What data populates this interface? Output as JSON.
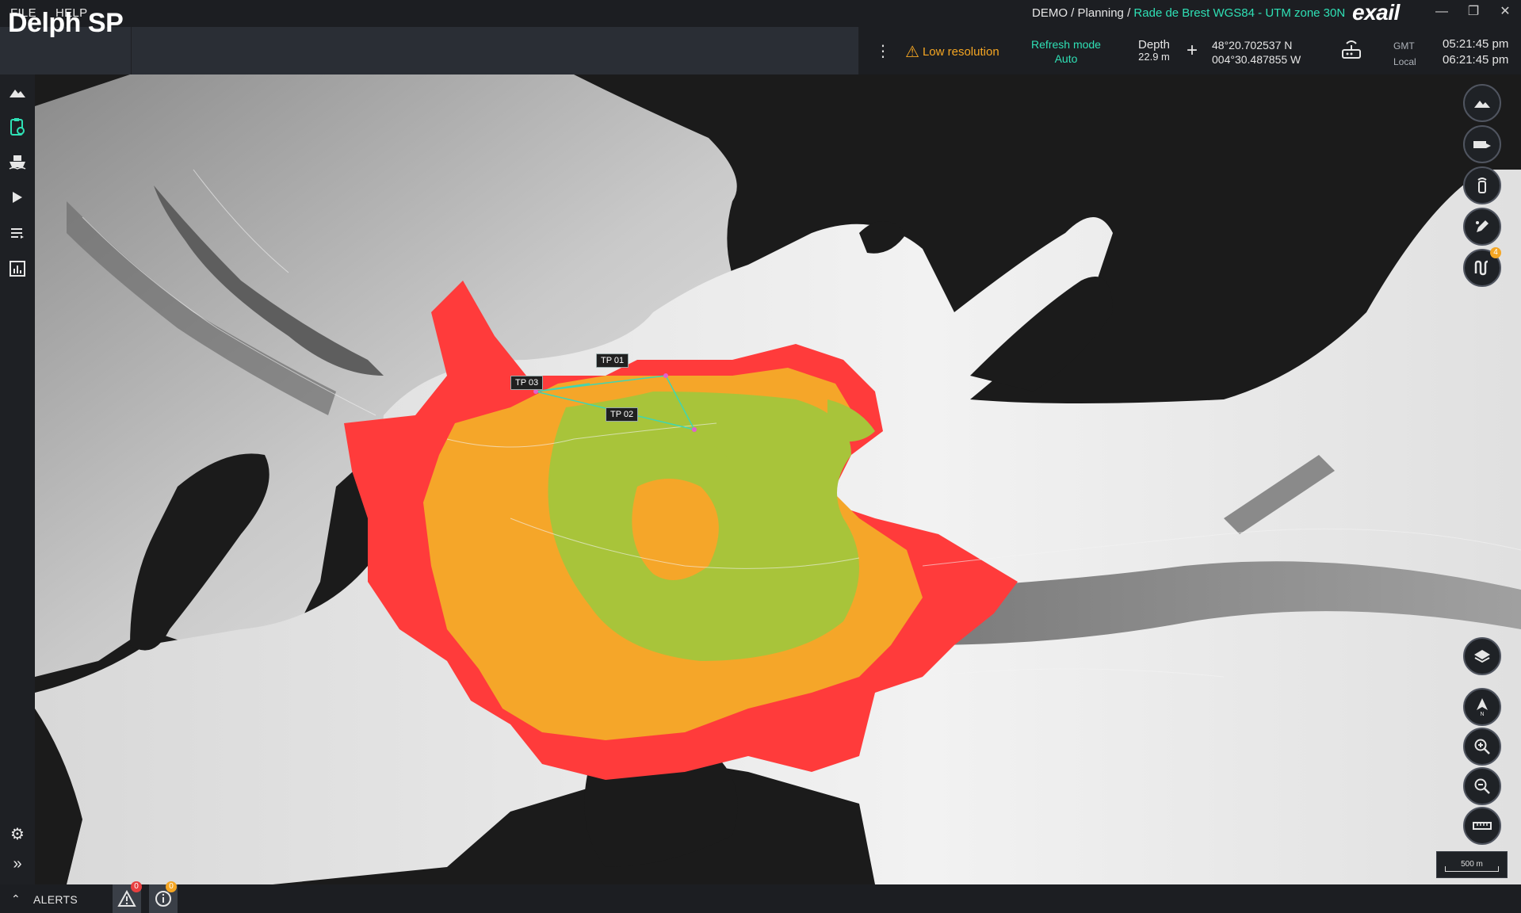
{
  "menu": {
    "file": "FILE",
    "help": "HELP"
  },
  "breadcrumb": {
    "part1": "DEMO",
    "sep1": " / ",
    "part2": "Planning",
    "sep2": " / ",
    "project": "Rade de Brest WGS84 - UTM zone 30N"
  },
  "brand": "exail",
  "app_title": "Delph SP",
  "status": {
    "warning": "Low resolution",
    "refresh_label": "Refresh mode",
    "refresh_value": "Auto",
    "depth_label": "Depth",
    "depth_value": "22.9 m",
    "lat": "48°20.702537 N",
    "lon": "004°30.487855 W",
    "tz_gmt": "GMT",
    "tz_local": "Local",
    "time_gmt": "05:21:45 pm",
    "time_local": "06:21:45 pm"
  },
  "sidebar_icons": [
    "terrain-icon",
    "clipboard-clock-icon",
    "ship-icon",
    "play-icon",
    "list-icon",
    "bar-chart-icon",
    "gear-icon",
    "double-chevron-right-icon"
  ],
  "map": {
    "targets": [
      {
        "id": "tp01",
        "label": "TP 01"
      },
      {
        "id": "tp02",
        "label": "TP 02"
      },
      {
        "id": "tp03",
        "label": "TP 03"
      }
    ],
    "scale_label": "500 m",
    "colors": {
      "red": "#ff3b3b",
      "orange": "#f5a629",
      "green": "#a8c43a",
      "link": "#3fd6b2",
      "target": "#e060d0"
    }
  },
  "right_controls": {
    "badge_count": "4"
  },
  "bottom": {
    "alerts_label": "ALERTS",
    "warn_count": "0",
    "info_count": "0"
  }
}
